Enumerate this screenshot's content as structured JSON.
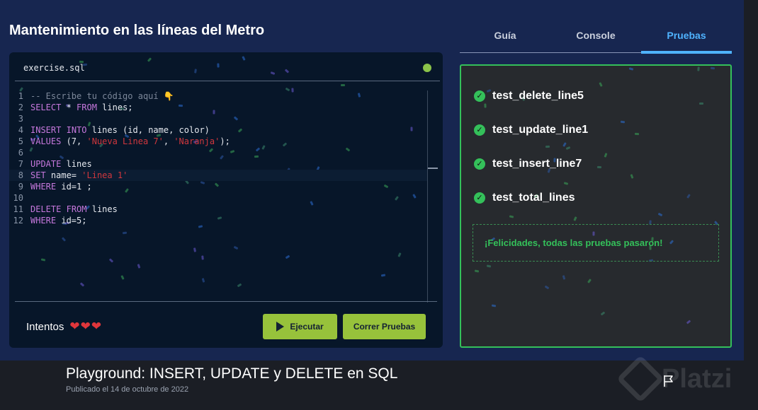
{
  "page": {
    "title": "Mantenimiento en las líneas del Metro"
  },
  "editor": {
    "filename": "exercise.sql",
    "lines": [
      {
        "n": "1",
        "tokens": [
          {
            "t": "-- Escribe tu código aquí 👇",
            "c": "comment"
          }
        ]
      },
      {
        "n": "2",
        "tokens": [
          {
            "t": "SELECT",
            "c": "kw"
          },
          {
            "t": " * ",
            "c": "op"
          },
          {
            "t": "FROM",
            "c": "kw"
          },
          {
            "t": " lines;",
            "c": "text"
          }
        ]
      },
      {
        "n": "3",
        "tokens": []
      },
      {
        "n": "4",
        "tokens": [
          {
            "t": "INSERT",
            "c": "kw"
          },
          {
            "t": " ",
            "c": "text"
          },
          {
            "t": "INTO",
            "c": "kw"
          },
          {
            "t": " lines (id, name, color)",
            "c": "text"
          }
        ]
      },
      {
        "n": "5",
        "tokens": [
          {
            "t": "VALUES",
            "c": "kw"
          },
          {
            "t": " (7, ",
            "c": "text"
          },
          {
            "t": "'Nueva Linea 7'",
            "c": "str"
          },
          {
            "t": ", ",
            "c": "text"
          },
          {
            "t": "'Naranja'",
            "c": "str"
          },
          {
            "t": ");",
            "c": "text"
          }
        ]
      },
      {
        "n": "6",
        "tokens": []
      },
      {
        "n": "7",
        "tokens": [
          {
            "t": "UPDATE",
            "c": "kw"
          },
          {
            "t": " lines",
            "c": "text"
          }
        ]
      },
      {
        "n": "8",
        "tokens": [
          {
            "t": "SET",
            "c": "kw"
          },
          {
            "t": " name= ",
            "c": "text"
          },
          {
            "t": "'Linea 1'",
            "c": "str"
          }
        ],
        "active": true
      },
      {
        "n": "9",
        "tokens": [
          {
            "t": "WHERE",
            "c": "kw"
          },
          {
            "t": " id=1 ;",
            "c": "text"
          }
        ]
      },
      {
        "n": "10",
        "tokens": []
      },
      {
        "n": "11",
        "tokens": [
          {
            "t": "DELETE",
            "c": "kw"
          },
          {
            "t": " ",
            "c": "text"
          },
          {
            "t": "FROM",
            "c": "kw"
          },
          {
            "t": " lines",
            "c": "text"
          }
        ]
      },
      {
        "n": "12",
        "tokens": [
          {
            "t": "WHERE",
            "c": "kw"
          },
          {
            "t": " id=5;",
            "c": "text"
          }
        ]
      }
    ],
    "attempts_label": "Intentos",
    "attempts_hearts": "❤❤❤",
    "run_label": "Ejecutar",
    "tests_label": "Correr Pruebas"
  },
  "tabs": [
    {
      "label": "Guía"
    },
    {
      "label": "Console"
    },
    {
      "label": "Pruebas",
      "active": true
    }
  ],
  "results": {
    "tests": [
      "test_delete_line5",
      "test_update_line1",
      "test_insert_line7",
      "test_total_lines"
    ],
    "success_message": "¡Felicidades, todas las pruebas pasaron!"
  },
  "video": {
    "title": "Playground: INSERT, UPDATE y DELETE en SQL",
    "date": "Publicado el 14 de octubre de 2022",
    "watermark": "Platzi"
  },
  "colors": {
    "accent": "#4fb3ff",
    "success": "#34c05a",
    "button": "#97c23b",
    "danger": "#e0363b"
  }
}
